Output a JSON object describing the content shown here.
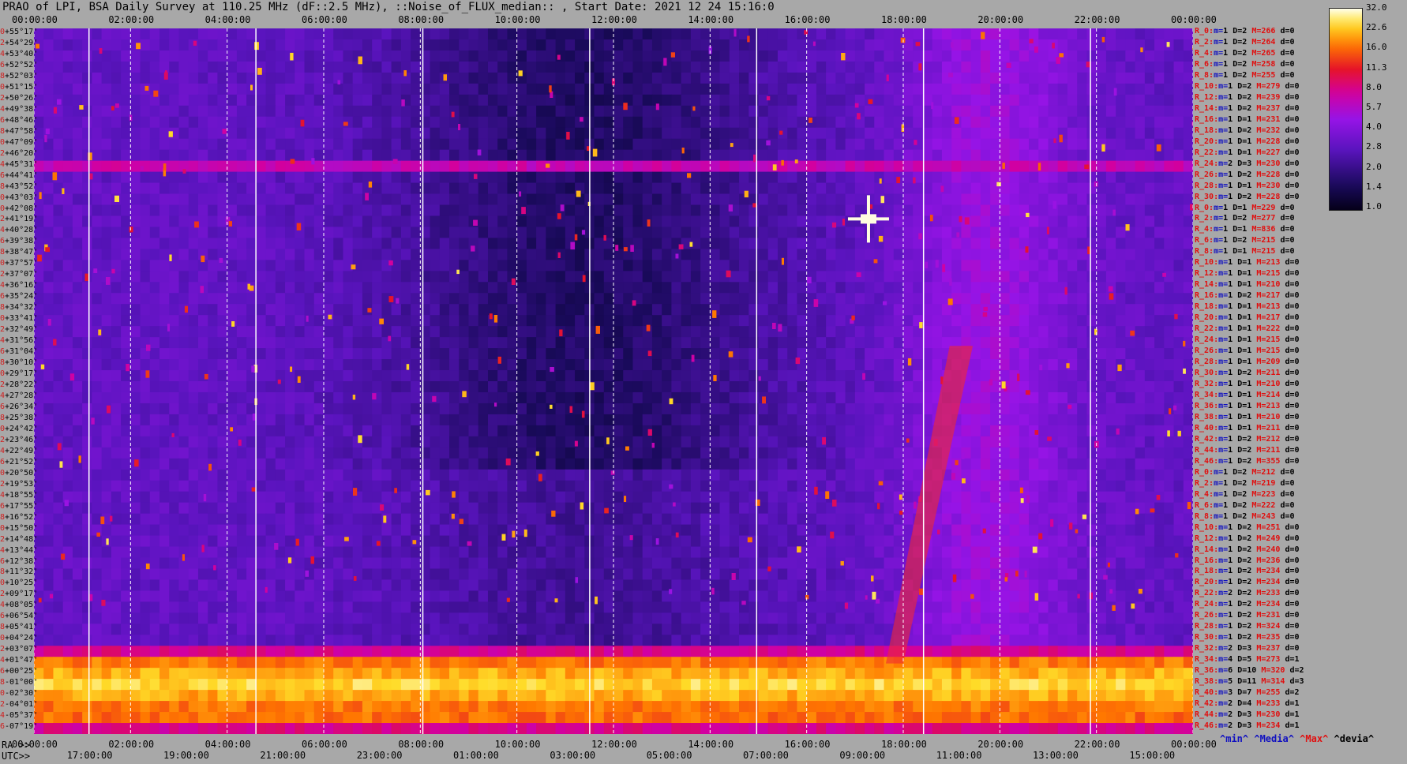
{
  "title": "PRAO of LPI, BSA Daily Survey at 110.25 MHz (dF::2.5 MHz), ::Noise_of_FLUX_median:: , Start Date: 2021 12 24 15:16:0",
  "corner": {
    "ra_label": "RA >>",
    "utc_label": "UTC>>"
  },
  "ra_ticks_top": [
    "00:00:00",
    "02:00:00",
    "04:00:00",
    "06:00:00",
    "08:00:00",
    "10:00:00",
    "12:00:00",
    "14:00:00",
    "16:00:00",
    "18:00:00",
    "20:00:00",
    "22:00:00",
    "00:00:00"
  ],
  "ra_ticks_bottom": [
    "00:00:00",
    "02:00:00",
    "04:00:00",
    "06:00:00",
    "08:00:00",
    "10:00:00",
    "12:00:00",
    "14:00:00",
    "16:00:00",
    "18:00:00",
    "20:00:00",
    "22:00:00",
    "00:00:00"
  ],
  "utc_ticks": [
    "17:00:00",
    "19:00:00",
    "21:00:00",
    "23:00:00",
    "01:00:00",
    "03:00:00",
    "05:00:00",
    "07:00:00",
    "09:00:00",
    "11:00:00",
    "13:00:00",
    "15:00:00"
  ],
  "colorbar": {
    "labels": [
      "32.0",
      "22.6",
      "16.0",
      "11.3",
      "8.0",
      "5.7",
      "4.0",
      "2.8",
      "2.0",
      "1.4",
      "1.0"
    ]
  },
  "footer_keys": [
    "^min^",
    "^Media^",
    "^Max^",
    "^devia^"
  ],
  "chart_data": {
    "type": "heatmap",
    "title": "PRAO of LPI, BSA Daily Survey at 110.25 MHz (dF::2.5 MHz), ::Noise_of_FLUX_median:: , Start Date: 2021 12 24 15:16:0",
    "xlabel": "RA",
    "x_unit": "hh:mm:ss",
    "xlim": [
      "00:00:00",
      "24:00:00"
    ],
    "y_labels": [
      "+55°17'",
      "+54°29'",
      "+53°40'",
      "+52°52'",
      "+52°03'",
      "+51°15'",
      "+50°26'",
      "+49°38'",
      "+48°46'",
      "+47°58'",
      "+47°09'",
      "+46°20'",
      "+45°31'",
      "+44°41'",
      "+43°52'",
      "+43°03'",
      "+42°08'",
      "+41°19'",
      "+40°28'",
      "+39°38'",
      "+38°47'",
      "+37°57'",
      "+37°07'",
      "+36°16'",
      "+35°24'",
      "+34°32'",
      "+33°41'",
      "+32°49'",
      "+31°56'",
      "+31°04'",
      "+30°10'",
      "+29°17'",
      "+28°22'",
      "+27°28'",
      "+26°34'",
      "+25°38'",
      "+24°42'",
      "+23°46'",
      "+22°49'",
      "+21°52'",
      "+20°50'",
      "+19°53'",
      "+18°55'",
      "+17°55'",
      "+16°52'",
      "+15°50'",
      "+14°48'",
      "+13°44'",
      "+12°38'",
      "+11°32'",
      "+10°25'",
      "+09°17'",
      "+08°05'",
      "+06°54'",
      "+05°41'",
      "+04°24'",
      "+03°07'",
      "+01°47'",
      "+00°25'",
      "-01°00'",
      "-02°30'",
      "-04°01'",
      "-05°37'",
      "-07°19'"
    ],
    "y_index": [
      "0",
      "2",
      "4",
      "6",
      "8",
      "10",
      "12",
      "14",
      "16",
      "18",
      "20",
      "22",
      "24",
      "26",
      "28",
      "30",
      "0",
      "2",
      "4",
      "6",
      "8",
      "10",
      "12",
      "14",
      "16",
      "18",
      "20",
      "22",
      "24",
      "26",
      "28",
      "30",
      "32",
      "34",
      "36",
      "38",
      "40",
      "42",
      "44",
      "46",
      "0",
      "2",
      "4",
      "6",
      "8",
      "10",
      "12",
      "14",
      "16",
      "18",
      "20",
      "22",
      "24",
      "26",
      "28",
      "30",
      "32",
      "34",
      "36",
      "38",
      "40",
      "42",
      "44",
      "46"
    ],
    "colorbar": {
      "min": 1.0,
      "max": 32.0,
      "scale": "log2",
      "ticks": [
        32.0,
        22.6,
        16.0,
        11.3,
        8.0,
        5.7,
        4.0,
        2.8,
        2.0,
        1.4,
        1.0
      ]
    },
    "beam_stats": [
      {
        "label": "R_0:",
        "m": "1",
        "d": "2",
        "h": "266",
        "dv": "0"
      },
      {
        "label": "R_2:",
        "m": "1",
        "d": "2",
        "h": "264",
        "dv": "0"
      },
      {
        "label": "R_4:",
        "m": "1",
        "d": "2",
        "h": "265",
        "dv": "0"
      },
      {
        "label": "R_6:",
        "m": "1",
        "d": "2",
        "h": "258",
        "dv": "0"
      },
      {
        "label": "R_8:",
        "m": "1",
        "d": "2",
        "h": "255",
        "dv": "0"
      },
      {
        "label": "R_10:",
        "m": "1",
        "d": "2",
        "h": "279",
        "dv": "0"
      },
      {
        "label": "R_12:",
        "m": "1",
        "d": "2",
        "h": "239",
        "dv": "0"
      },
      {
        "label": "R_14:",
        "m": "1",
        "d": "2",
        "h": "237",
        "dv": "0"
      },
      {
        "label": "R_16:",
        "m": "1",
        "d": "1",
        "h": "231",
        "dv": "0"
      },
      {
        "label": "R_18:",
        "m": "1",
        "d": "2",
        "h": "232",
        "dv": "0"
      },
      {
        "label": "R_20:",
        "m": "1",
        "d": "1",
        "h": "228",
        "dv": "0"
      },
      {
        "label": "R_22:",
        "m": "1",
        "d": "1",
        "h": "227",
        "dv": "0"
      },
      {
        "label": "R_24:",
        "m": "2",
        "d": "3",
        "h": "230",
        "dv": "0"
      },
      {
        "label": "R_26:",
        "m": "1",
        "d": "2",
        "h": "228",
        "dv": "0"
      },
      {
        "label": "R_28:",
        "m": "1",
        "d": "1",
        "h": "230",
        "dv": "0"
      },
      {
        "label": "R_30:",
        "m": "1",
        "d": "2",
        "h": "228",
        "dv": "0"
      },
      {
        "label": "R_0:",
        "m": "1",
        "d": "1",
        "h": "229",
        "dv": "0"
      },
      {
        "label": "R_2:",
        "m": "1",
        "d": "2",
        "h": "277",
        "dv": "0"
      },
      {
        "label": "R_4:",
        "m": "1",
        "d": "1",
        "h": "836",
        "dv": "0"
      },
      {
        "label": "R_6:",
        "m": "1",
        "d": "2",
        "h": "215",
        "dv": "0"
      },
      {
        "label": "R_8:",
        "m": "1",
        "d": "1",
        "h": "215",
        "dv": "0"
      },
      {
        "label": "R_10:",
        "m": "1",
        "d": "1",
        "h": "213",
        "dv": "0"
      },
      {
        "label": "R_12:",
        "m": "1",
        "d": "1",
        "h": "215",
        "dv": "0"
      },
      {
        "label": "R_14:",
        "m": "1",
        "d": "1",
        "h": "210",
        "dv": "0"
      },
      {
        "label": "R_16:",
        "m": "1",
        "d": "2",
        "h": "217",
        "dv": "0"
      },
      {
        "label": "R_18:",
        "m": "1",
        "d": "1",
        "h": "213",
        "dv": "0"
      },
      {
        "label": "R_20:",
        "m": "1",
        "d": "1",
        "h": "217",
        "dv": "0"
      },
      {
        "label": "R_22:",
        "m": "1",
        "d": "1",
        "h": "222",
        "dv": "0"
      },
      {
        "label": "R_24:",
        "m": "1",
        "d": "1",
        "h": "215",
        "dv": "0"
      },
      {
        "label": "R_26:",
        "m": "1",
        "d": "1",
        "h": "215",
        "dv": "0"
      },
      {
        "label": "R_28:",
        "m": "1",
        "d": "1",
        "h": "209",
        "dv": "0"
      },
      {
        "label": "R_30:",
        "m": "1",
        "d": "2",
        "h": "211",
        "dv": "0"
      },
      {
        "label": "R_32:",
        "m": "1",
        "d": "1",
        "h": "210",
        "dv": "0"
      },
      {
        "label": "R_34:",
        "m": "1",
        "d": "1",
        "h": "214",
        "dv": "0"
      },
      {
        "label": "R_36:",
        "m": "1",
        "d": "1",
        "h": "213",
        "dv": "0"
      },
      {
        "label": "R_38:",
        "m": "1",
        "d": "1",
        "h": "210",
        "dv": "0"
      },
      {
        "label": "R_40:",
        "m": "1",
        "d": "1",
        "h": "211",
        "dv": "0"
      },
      {
        "label": "R_42:",
        "m": "1",
        "d": "2",
        "h": "212",
        "dv": "0"
      },
      {
        "label": "R_44:",
        "m": "1",
        "d": "2",
        "h": "211",
        "dv": "0"
      },
      {
        "label": "R_46:",
        "m": "1",
        "d": "2",
        "h": "355",
        "dv": "0"
      },
      {
        "label": "R_0:",
        "m": "1",
        "d": "2",
        "h": "212",
        "dv": "0"
      },
      {
        "label": "R_2:",
        "m": "1",
        "d": "2",
        "h": "219",
        "dv": "0"
      },
      {
        "label": "R_4:",
        "m": "1",
        "d": "2",
        "h": "223",
        "dv": "0"
      },
      {
        "label": "R_6:",
        "m": "1",
        "d": "2",
        "h": "222",
        "dv": "0"
      },
      {
        "label": "R_8:",
        "m": "1",
        "d": "2",
        "h": "243",
        "dv": "0"
      },
      {
        "label": "R_10:",
        "m": "1",
        "d": "2",
        "h": "251",
        "dv": "0"
      },
      {
        "label": "R_12:",
        "m": "1",
        "d": "2",
        "h": "249",
        "dv": "0"
      },
      {
        "label": "R_14:",
        "m": "1",
        "d": "2",
        "h": "240",
        "dv": "0"
      },
      {
        "label": "R_16:",
        "m": "1",
        "d": "2",
        "h": "236",
        "dv": "0"
      },
      {
        "label": "R_18:",
        "m": "1",
        "d": "2",
        "h": "234",
        "dv": "0"
      },
      {
        "label": "R_20:",
        "m": "1",
        "d": "2",
        "h": "234",
        "dv": "0"
      },
      {
        "label": "R_22:",
        "m": "2",
        "d": "2",
        "h": "233",
        "dv": "0"
      },
      {
        "label": "R_24:",
        "m": "1",
        "d": "2",
        "h": "234",
        "dv": "0"
      },
      {
        "label": "R_26:",
        "m": "1",
        "d": "2",
        "h": "231",
        "dv": "0"
      },
      {
        "label": "R_28:",
        "m": "1",
        "d": "2",
        "h": "324",
        "dv": "0"
      },
      {
        "label": "R_30:",
        "m": "1",
        "d": "2",
        "h": "235",
        "dv": "0"
      },
      {
        "label": "R_32:",
        "m": "2",
        "d": "3",
        "h": "237",
        "dv": "0"
      },
      {
        "label": "R_34:",
        "m": "4",
        "d": "5",
        "h": "273",
        "dv": "1"
      },
      {
        "label": "R_36:",
        "m": "6",
        "d": "10",
        "h": "320",
        "dv": "2"
      },
      {
        "label": "R_38:",
        "m": "5",
        "d": "11",
        "h": "314",
        "dv": "3"
      },
      {
        "label": "R_40:",
        "m": "3",
        "d": "7",
        "h": "255",
        "dv": "2"
      },
      {
        "label": "R_42:",
        "m": "2",
        "d": "4",
        "h": "233",
        "dv": "1"
      },
      {
        "label": "R_44:",
        "m": "2",
        "d": "3",
        "h": "230",
        "dv": "1"
      },
      {
        "label": "R_46:",
        "m": "2",
        "d": "3",
        "h": "234",
        "dv": "1"
      }
    ]
  }
}
